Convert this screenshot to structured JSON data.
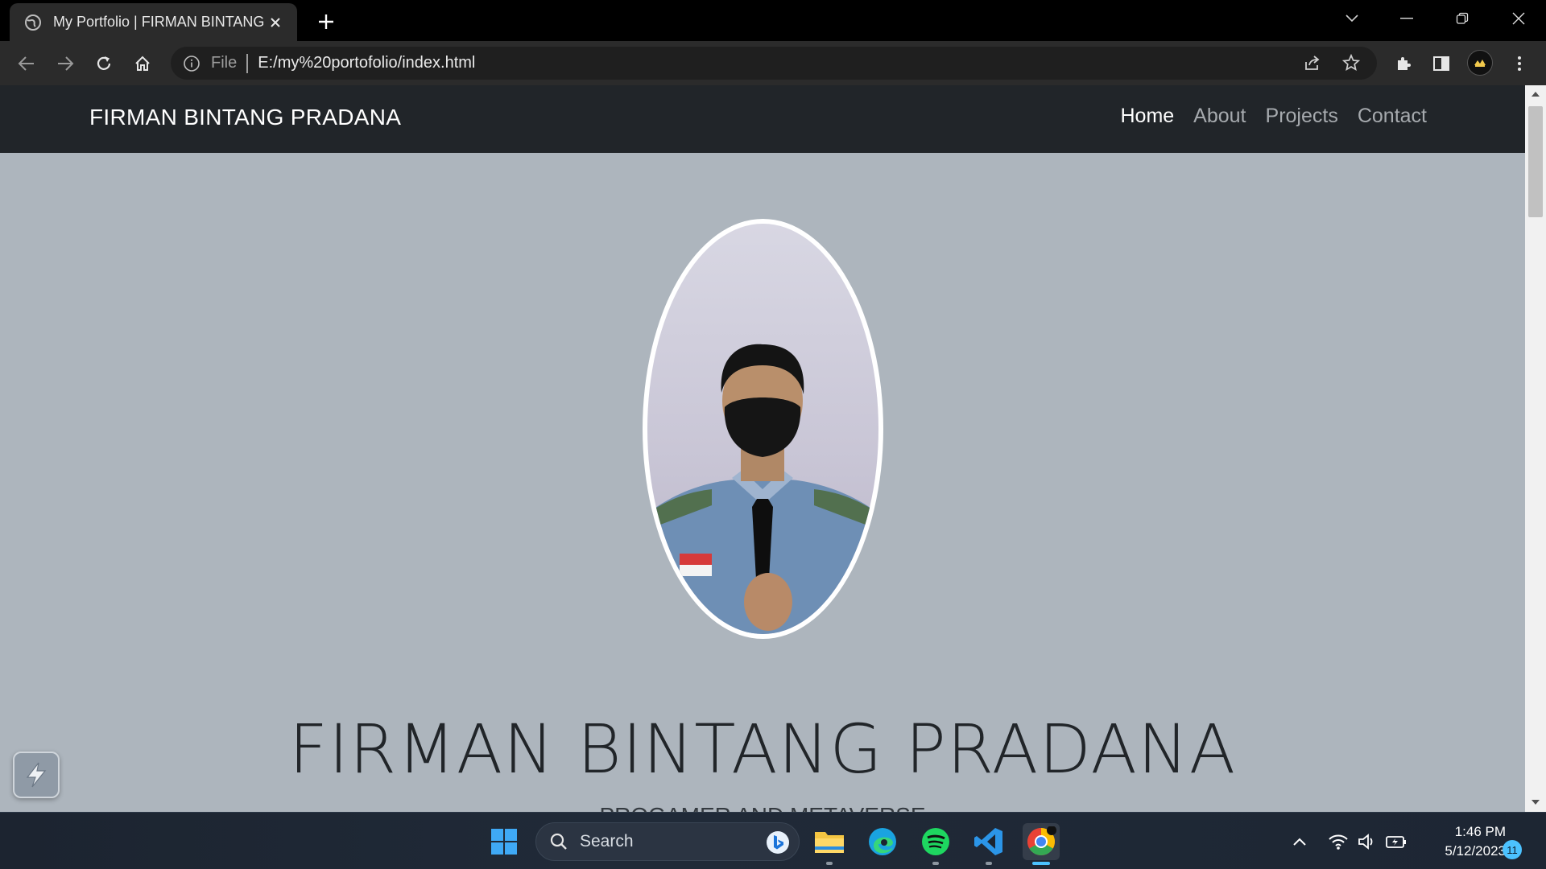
{
  "browser": {
    "tab_title": "My Portfolio | FIRMAN BINTANG",
    "url_scheme": "File",
    "url": "E:/my%20portofolio/index.html"
  },
  "site": {
    "brand": "FIRMAN BINTANG PRADANA",
    "nav": [
      {
        "label": "Home",
        "active": true
      },
      {
        "label": "About",
        "active": false
      },
      {
        "label": "Projects",
        "active": false
      },
      {
        "label": "Contact",
        "active": false
      }
    ],
    "hero": {
      "name": "FIRMAN BINTANG PRADANA",
      "subtitle": "PROGAMER AND METAVERSE"
    }
  },
  "taskbar": {
    "search_label": "Search",
    "apps": [
      "start-icon",
      "file-explorer-icon",
      "edge-icon",
      "spotify-icon",
      "vscode-icon",
      "chrome-icon"
    ],
    "time": "1:46 PM",
    "date": "5/12/2023",
    "notification_count": "11"
  },
  "colors": {
    "page_bg": "#adb5bd",
    "navbar_bg": "#212529",
    "browser_chrome": "#2b2b2b"
  }
}
